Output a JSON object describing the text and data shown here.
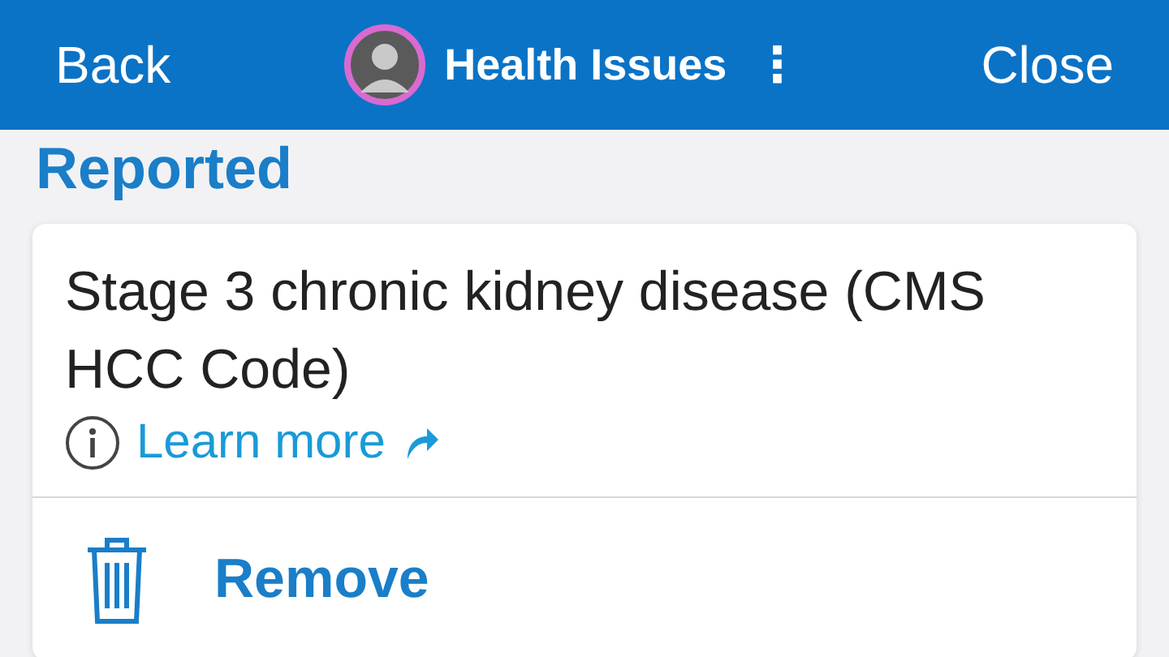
{
  "header": {
    "back": "Back",
    "title": "Health Issues",
    "more": "⋮",
    "close": "Close"
  },
  "section_title": "Reported",
  "issue": {
    "name": "Stage 3 chronic kidney disease (CMS HCC Code)",
    "link": "Learn more",
    "action": "Remove"
  }
}
